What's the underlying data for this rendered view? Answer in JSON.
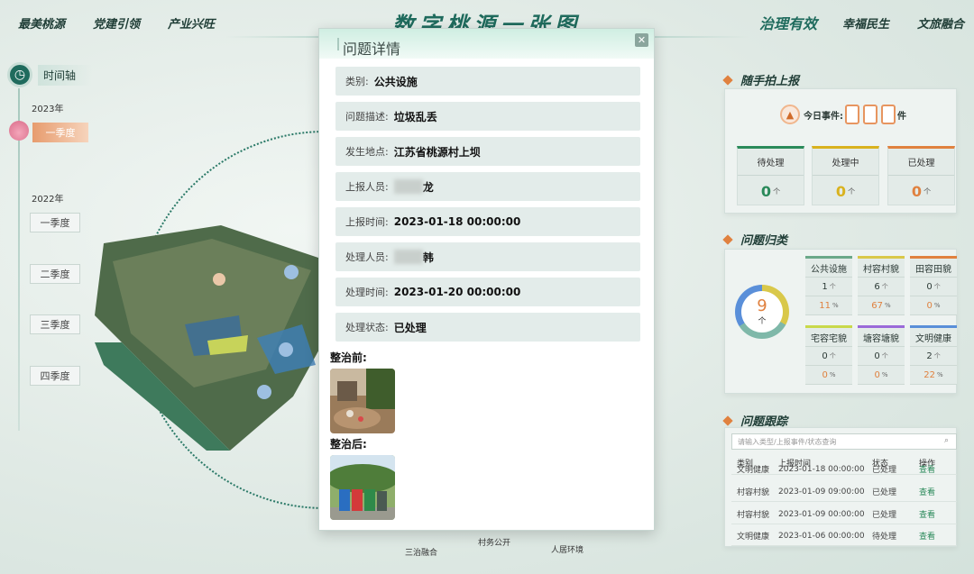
{
  "header": {
    "title": "数字桃源一张图",
    "nav_left": [
      "最美桃源",
      "党建引领",
      "产业兴旺"
    ],
    "nav_right": [
      "治理有效",
      "幸福民生",
      "文旅融合"
    ],
    "active_nav": "治理有效"
  },
  "timeline": {
    "label": "时间轴",
    "year1": "2023年",
    "q_active": "一季度",
    "year2": "2022年",
    "quarters": [
      "一季度",
      "二季度",
      "三季度",
      "四季度"
    ]
  },
  "report": {
    "title": "随手拍上报",
    "today_label": "今日事件:",
    "today_unit": "件",
    "stats": [
      {
        "label": "待处理",
        "value": "0",
        "unit": "个",
        "color": "#2a8a5a"
      },
      {
        "label": "处理中",
        "value": "0",
        "unit": "个",
        "color": "#d9b21e"
      },
      {
        "label": "已处理",
        "value": "0",
        "unit": "个",
        "color": "#e0813f"
      }
    ]
  },
  "category": {
    "title": "问题归类",
    "total": "9",
    "total_unit": "个",
    "items": [
      {
        "name": "公共设施",
        "count": "1",
        "unit": "个",
        "pct": "11",
        "pct_unit": "%",
        "color": "#6ba889"
      },
      {
        "name": "村容村貌",
        "count": "6",
        "unit": "个",
        "pct": "67",
        "pct_unit": "%",
        "color": "#d9c84a"
      },
      {
        "name": "田容田貌",
        "count": "0",
        "unit": "个",
        "pct": "0",
        "pct_unit": "%",
        "color": "#e0813f"
      },
      {
        "name": "宅容宅貌",
        "count": "0",
        "unit": "个",
        "pct": "0",
        "pct_unit": "%",
        "color": "#c9d94a"
      },
      {
        "name": "塘容塘貌",
        "count": "0",
        "unit": "个",
        "pct": "0",
        "pct_unit": "%",
        "color": "#9b6ad9"
      },
      {
        "name": "文明健康",
        "count": "2",
        "unit": "个",
        "pct": "22",
        "pct_unit": "%",
        "color": "#5a8fd9"
      }
    ]
  },
  "tracking": {
    "title": "问题跟踪",
    "search_placeholder": "请输入类型/上报事件/状态查询",
    "headers": [
      "类别",
      "上报时间",
      "状态",
      "操作"
    ],
    "rows": [
      {
        "cat": "文明健康",
        "time": "2023-01-18 00:00:00",
        "status": "已处理",
        "op": "查看"
      },
      {
        "cat": "村容村貌",
        "time": "2023-01-09 09:00:00",
        "status": "已处理",
        "op": "查看"
      },
      {
        "cat": "村容村貌",
        "time": "2023-01-09 00:00:00",
        "status": "已处理",
        "op": "查看"
      },
      {
        "cat": "文明健康",
        "time": "2023-01-06 00:00:00",
        "status": "待处理",
        "op": "查看"
      }
    ]
  },
  "bottom": {
    "items": [
      "三治融合",
      "村务公开",
      "人居环境"
    ]
  },
  "modal": {
    "title": "问题详情",
    "fields": [
      {
        "key": "类别:",
        "value": "公共设施"
      },
      {
        "key": "问题描述:",
        "value": "垃圾乱丢"
      },
      {
        "key": "发生地点:",
        "value": "江苏省桃源村上坝"
      },
      {
        "key": "上报人员:",
        "value": "龙"
      },
      {
        "key": "上报时间:",
        "value": "2023-01-18 00:00:00"
      },
      {
        "key": "处理人员:",
        "value": "韩"
      },
      {
        "key": "处理时间:",
        "value": "2023-01-20 00:00:00"
      },
      {
        "key": "处理状态:",
        "value": "已处理"
      }
    ],
    "before_label": "整治前:",
    "after_label": "整治后:",
    "close_icon": "close-icon"
  }
}
